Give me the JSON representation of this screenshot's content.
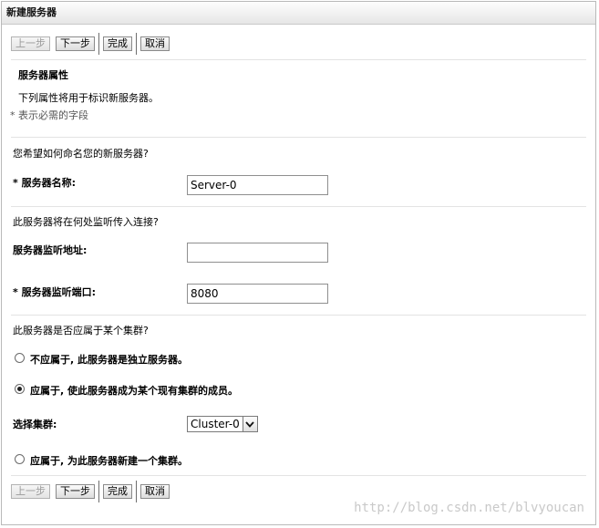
{
  "window": {
    "title": "新建服务器"
  },
  "toolbar": {
    "back": "上一步",
    "next": "下一步",
    "finish": "完成",
    "cancel": "取消"
  },
  "section": {
    "heading": "服务器属性",
    "description": "下列属性将用于标识新服务器。",
    "required_note": "* 表示必需的字段"
  },
  "name_group": {
    "question": "您希望如何命名您的新服务器?",
    "label_star": "*",
    "label": "服务器名称:",
    "value": "Server-0"
  },
  "listen_group": {
    "question": "此服务器将在何处监听传入连接?",
    "address_label": "服务器监听地址:",
    "address_value": "",
    "port_label_star": "*",
    "port_label": "服务器监听端口:",
    "port_value": "8080"
  },
  "cluster_group": {
    "question": "此服务器是否应属于某个集群?",
    "option_standalone": "不应属于, 此服务器是独立服务器。",
    "option_existing": "应属于, 使此服务器成为某个现有集群的成员。",
    "select_label": "选择集群:",
    "select_value": "Cluster-0",
    "option_new": "应属于, 为此服务器新建一个集群。",
    "selected_option": "existing"
  },
  "watermark": "http://blog.csdn.net/blvyoucan"
}
